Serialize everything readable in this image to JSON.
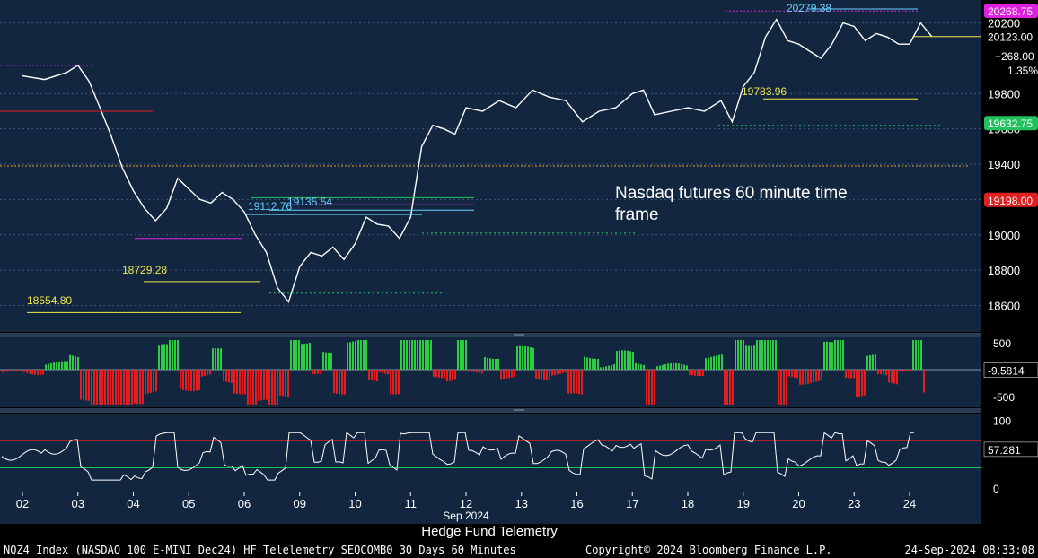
{
  "chart_data": {
    "type": "line",
    "title": "Hedge Fund Telemetry",
    "annotation": "Nasdaq futures 60 minute time frame",
    "footer_left": "NQZ4 Index (NASDAQ 100 E-MINI Dec24) HF Telelemetry SEQCOMB0 30 Days 60 Minutes",
    "footer_mid": "Copyright© 2024 Bloomberg Finance L.P.",
    "footer_right": "24-Sep-2024 08:33:08",
    "month_label": "Sep 2024",
    "x_ticks": [
      "02",
      "03",
      "04",
      "05",
      "06",
      "09",
      "10",
      "11",
      "12",
      "13",
      "16",
      "17",
      "18",
      "19",
      "20",
      "23",
      "24"
    ],
    "price_panel": {
      "ylim": [
        18450,
        20330
      ],
      "y_ticks": [
        18600,
        18800,
        19000,
        19200,
        19400,
        19600,
        19800,
        20200
      ],
      "right_tags": [
        {
          "text": "20268.75",
          "value": 20268.75,
          "color": "#e020e0",
          "text_color": "#ffffff"
        },
        {
          "text": "20123.00",
          "value": 20123.0,
          "color": "#000000",
          "text_color": "#ffffff"
        },
        {
          "text": "19632.75",
          "value": 19632.75,
          "color": "#22c35e",
          "text_color": "#ffffff"
        },
        {
          "text": "19198.00",
          "value": 19198.0,
          "color": "#e02020",
          "text_color": "#ffffff"
        }
      ],
      "change_labels": [
        "+268.00",
        "1.35%"
      ],
      "level_labels": [
        {
          "text": "20279.38",
          "color": "#6ad0ff"
        },
        {
          "text": "19783.96",
          "color": "#f3e84a"
        },
        {
          "text": "19135.54",
          "color": "#6ad0ff"
        },
        {
          "text": "19112.76",
          "color": "#6ad0ff"
        },
        {
          "text": "18729.28",
          "color": "#f3e84a"
        },
        {
          "text": "18554.80",
          "color": "#f3e84a"
        }
      ],
      "price_path": [
        [
          0,
          19900
        ],
        [
          0.4,
          19880
        ],
        [
          0.8,
          19920
        ],
        [
          1.0,
          19960
        ],
        [
          1.2,
          19870
        ],
        [
          1.4,
          19720
        ],
        [
          1.6,
          19560
        ],
        [
          1.8,
          19380
        ],
        [
          2.0,
          19250
        ],
        [
          2.2,
          19150
        ],
        [
          2.4,
          19080
        ],
        [
          2.6,
          19150
        ],
        [
          2.8,
          19320
        ],
        [
          3.0,
          19260
        ],
        [
          3.2,
          19200
        ],
        [
          3.4,
          19180
        ],
        [
          3.6,
          19240
        ],
        [
          3.8,
          19200
        ],
        [
          4.0,
          19130
        ],
        [
          4.2,
          19000
        ],
        [
          4.4,
          18900
        ],
        [
          4.6,
          18700
        ],
        [
          4.8,
          18620
        ],
        [
          5.0,
          18820
        ],
        [
          5.2,
          18900
        ],
        [
          5.4,
          18880
        ],
        [
          5.6,
          18930
        ],
        [
          5.8,
          18860
        ],
        [
          6.0,
          18950
        ],
        [
          6.2,
          19100
        ],
        [
          6.4,
          19060
        ],
        [
          6.6,
          19050
        ],
        [
          6.8,
          18980
        ],
        [
          7.0,
          19100
        ],
        [
          7.2,
          19500
        ],
        [
          7.4,
          19620
        ],
        [
          7.6,
          19600
        ],
        [
          7.8,
          19570
        ],
        [
          8.0,
          19720
        ],
        [
          8.3,
          19700
        ],
        [
          8.6,
          19760
        ],
        [
          8.9,
          19720
        ],
        [
          9.2,
          19820
        ],
        [
          9.5,
          19780
        ],
        [
          9.8,
          19760
        ],
        [
          10.1,
          19640
        ],
        [
          10.4,
          19700
        ],
        [
          10.7,
          19720
        ],
        [
          11.0,
          19800
        ],
        [
          11.2,
          19820
        ],
        [
          11.4,
          19680
        ],
        [
          11.7,
          19700
        ],
        [
          12.0,
          19720
        ],
        [
          12.3,
          19700
        ],
        [
          12.6,
          19760
        ],
        [
          12.8,
          19640
        ],
        [
          13.0,
          19840
        ],
        [
          13.2,
          19920
        ],
        [
          13.4,
          20120
        ],
        [
          13.6,
          20220
        ],
        [
          13.8,
          20100
        ],
        [
          14.0,
          20080
        ],
        [
          14.2,
          20040
        ],
        [
          14.4,
          20000
        ],
        [
          14.6,
          20080
        ],
        [
          14.8,
          20200
        ],
        [
          15.0,
          20180
        ],
        [
          15.2,
          20100
        ],
        [
          15.4,
          20140
        ],
        [
          15.6,
          20120
        ],
        [
          15.8,
          20080
        ],
        [
          16.0,
          20080
        ],
        [
          16.2,
          20200
        ],
        [
          16.4,
          20123
        ]
      ]
    },
    "osc_panel": {
      "ylim": [
        -700,
        600
      ],
      "y_ticks": [
        500,
        -500
      ],
      "right_tags": [
        {
          "text": "-9.5814",
          "value": -9.5814
        }
      ]
    },
    "rsi_panel": {
      "ylim": [
        -5,
        110
      ],
      "y_ticks": [
        100,
        0
      ],
      "levels": [
        {
          "value": 70,
          "color": "#e02020"
        },
        {
          "value": 30,
          "color": "#22c35e"
        }
      ],
      "right_tags": [
        {
          "text": "57.281",
          "value": 57.281
        }
      ]
    }
  }
}
